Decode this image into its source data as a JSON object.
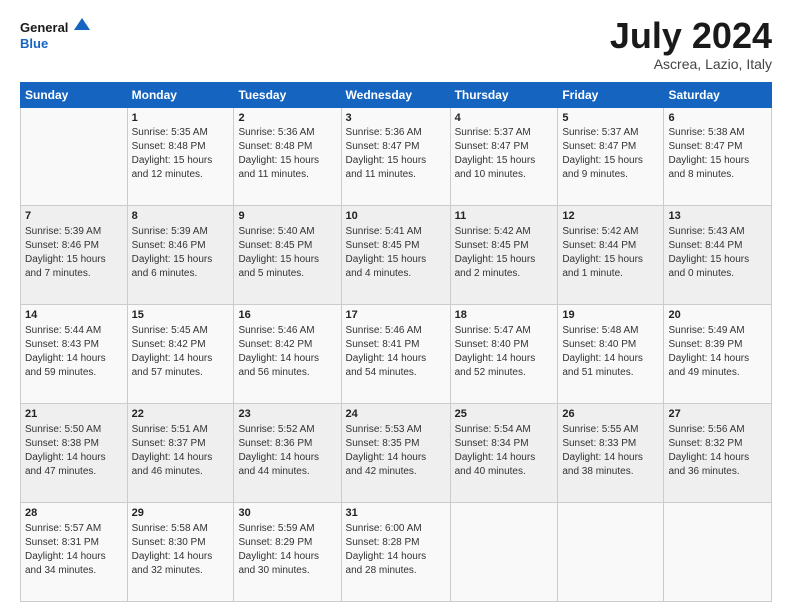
{
  "header": {
    "logo_line1": "General",
    "logo_line2": "Blue",
    "title": "July 2024",
    "subtitle": "Ascrea, Lazio, Italy"
  },
  "calendar": {
    "days_header": [
      "Sunday",
      "Monday",
      "Tuesday",
      "Wednesday",
      "Thursday",
      "Friday",
      "Saturday"
    ],
    "weeks": [
      [
        {
          "day": "",
          "info": ""
        },
        {
          "day": "1",
          "info": "Sunrise: 5:35 AM\nSunset: 8:48 PM\nDaylight: 15 hours\nand 12 minutes."
        },
        {
          "day": "2",
          "info": "Sunrise: 5:36 AM\nSunset: 8:48 PM\nDaylight: 15 hours\nand 11 minutes."
        },
        {
          "day": "3",
          "info": "Sunrise: 5:36 AM\nSunset: 8:47 PM\nDaylight: 15 hours\nand 11 minutes."
        },
        {
          "day": "4",
          "info": "Sunrise: 5:37 AM\nSunset: 8:47 PM\nDaylight: 15 hours\nand 10 minutes."
        },
        {
          "day": "5",
          "info": "Sunrise: 5:37 AM\nSunset: 8:47 PM\nDaylight: 15 hours\nand 9 minutes."
        },
        {
          "day": "6",
          "info": "Sunrise: 5:38 AM\nSunset: 8:47 PM\nDaylight: 15 hours\nand 8 minutes."
        }
      ],
      [
        {
          "day": "7",
          "info": "Sunrise: 5:39 AM\nSunset: 8:46 PM\nDaylight: 15 hours\nand 7 minutes."
        },
        {
          "day": "8",
          "info": "Sunrise: 5:39 AM\nSunset: 8:46 PM\nDaylight: 15 hours\nand 6 minutes."
        },
        {
          "day": "9",
          "info": "Sunrise: 5:40 AM\nSunset: 8:45 PM\nDaylight: 15 hours\nand 5 minutes."
        },
        {
          "day": "10",
          "info": "Sunrise: 5:41 AM\nSunset: 8:45 PM\nDaylight: 15 hours\nand 4 minutes."
        },
        {
          "day": "11",
          "info": "Sunrise: 5:42 AM\nSunset: 8:45 PM\nDaylight: 15 hours\nand 2 minutes."
        },
        {
          "day": "12",
          "info": "Sunrise: 5:42 AM\nSunset: 8:44 PM\nDaylight: 15 hours\nand 1 minute."
        },
        {
          "day": "13",
          "info": "Sunrise: 5:43 AM\nSunset: 8:44 PM\nDaylight: 15 hours\nand 0 minutes."
        }
      ],
      [
        {
          "day": "14",
          "info": "Sunrise: 5:44 AM\nSunset: 8:43 PM\nDaylight: 14 hours\nand 59 minutes."
        },
        {
          "day": "15",
          "info": "Sunrise: 5:45 AM\nSunset: 8:42 PM\nDaylight: 14 hours\nand 57 minutes."
        },
        {
          "day": "16",
          "info": "Sunrise: 5:46 AM\nSunset: 8:42 PM\nDaylight: 14 hours\nand 56 minutes."
        },
        {
          "day": "17",
          "info": "Sunrise: 5:46 AM\nSunset: 8:41 PM\nDaylight: 14 hours\nand 54 minutes."
        },
        {
          "day": "18",
          "info": "Sunrise: 5:47 AM\nSunset: 8:40 PM\nDaylight: 14 hours\nand 52 minutes."
        },
        {
          "day": "19",
          "info": "Sunrise: 5:48 AM\nSunset: 8:40 PM\nDaylight: 14 hours\nand 51 minutes."
        },
        {
          "day": "20",
          "info": "Sunrise: 5:49 AM\nSunset: 8:39 PM\nDaylight: 14 hours\nand 49 minutes."
        }
      ],
      [
        {
          "day": "21",
          "info": "Sunrise: 5:50 AM\nSunset: 8:38 PM\nDaylight: 14 hours\nand 47 minutes."
        },
        {
          "day": "22",
          "info": "Sunrise: 5:51 AM\nSunset: 8:37 PM\nDaylight: 14 hours\nand 46 minutes."
        },
        {
          "day": "23",
          "info": "Sunrise: 5:52 AM\nSunset: 8:36 PM\nDaylight: 14 hours\nand 44 minutes."
        },
        {
          "day": "24",
          "info": "Sunrise: 5:53 AM\nSunset: 8:35 PM\nDaylight: 14 hours\nand 42 minutes."
        },
        {
          "day": "25",
          "info": "Sunrise: 5:54 AM\nSunset: 8:34 PM\nDaylight: 14 hours\nand 40 minutes."
        },
        {
          "day": "26",
          "info": "Sunrise: 5:55 AM\nSunset: 8:33 PM\nDaylight: 14 hours\nand 38 minutes."
        },
        {
          "day": "27",
          "info": "Sunrise: 5:56 AM\nSunset: 8:32 PM\nDaylight: 14 hours\nand 36 minutes."
        }
      ],
      [
        {
          "day": "28",
          "info": "Sunrise: 5:57 AM\nSunset: 8:31 PM\nDaylight: 14 hours\nand 34 minutes."
        },
        {
          "day": "29",
          "info": "Sunrise: 5:58 AM\nSunset: 8:30 PM\nDaylight: 14 hours\nand 32 minutes."
        },
        {
          "day": "30",
          "info": "Sunrise: 5:59 AM\nSunset: 8:29 PM\nDaylight: 14 hours\nand 30 minutes."
        },
        {
          "day": "31",
          "info": "Sunrise: 6:00 AM\nSunset: 8:28 PM\nDaylight: 14 hours\nand 28 minutes."
        },
        {
          "day": "",
          "info": ""
        },
        {
          "day": "",
          "info": ""
        },
        {
          "day": "",
          "info": ""
        }
      ]
    ]
  }
}
